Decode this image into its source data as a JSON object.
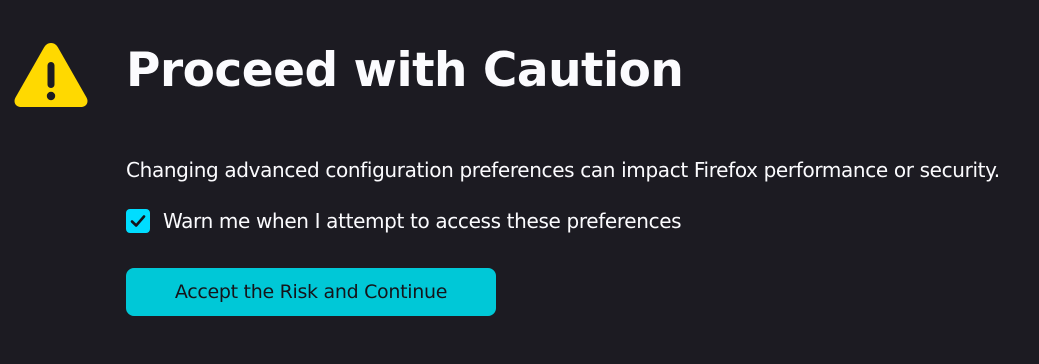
{
  "dialog": {
    "title": "Proceed with Caution",
    "description": "Changing advanced configuration preferences can impact Firefox performance or security.",
    "warn_checkbox": {
      "label": "Warn me when I attempt to access these preferences",
      "checked": true
    },
    "accept_button_label": "Accept the Risk and Continue",
    "icon": "warning-icon"
  },
  "colors": {
    "background": "#1c1b22",
    "text": "#fbfbfe",
    "accent": "#00ddff",
    "button": "#00c8d7",
    "warning": "#ffd900"
  }
}
